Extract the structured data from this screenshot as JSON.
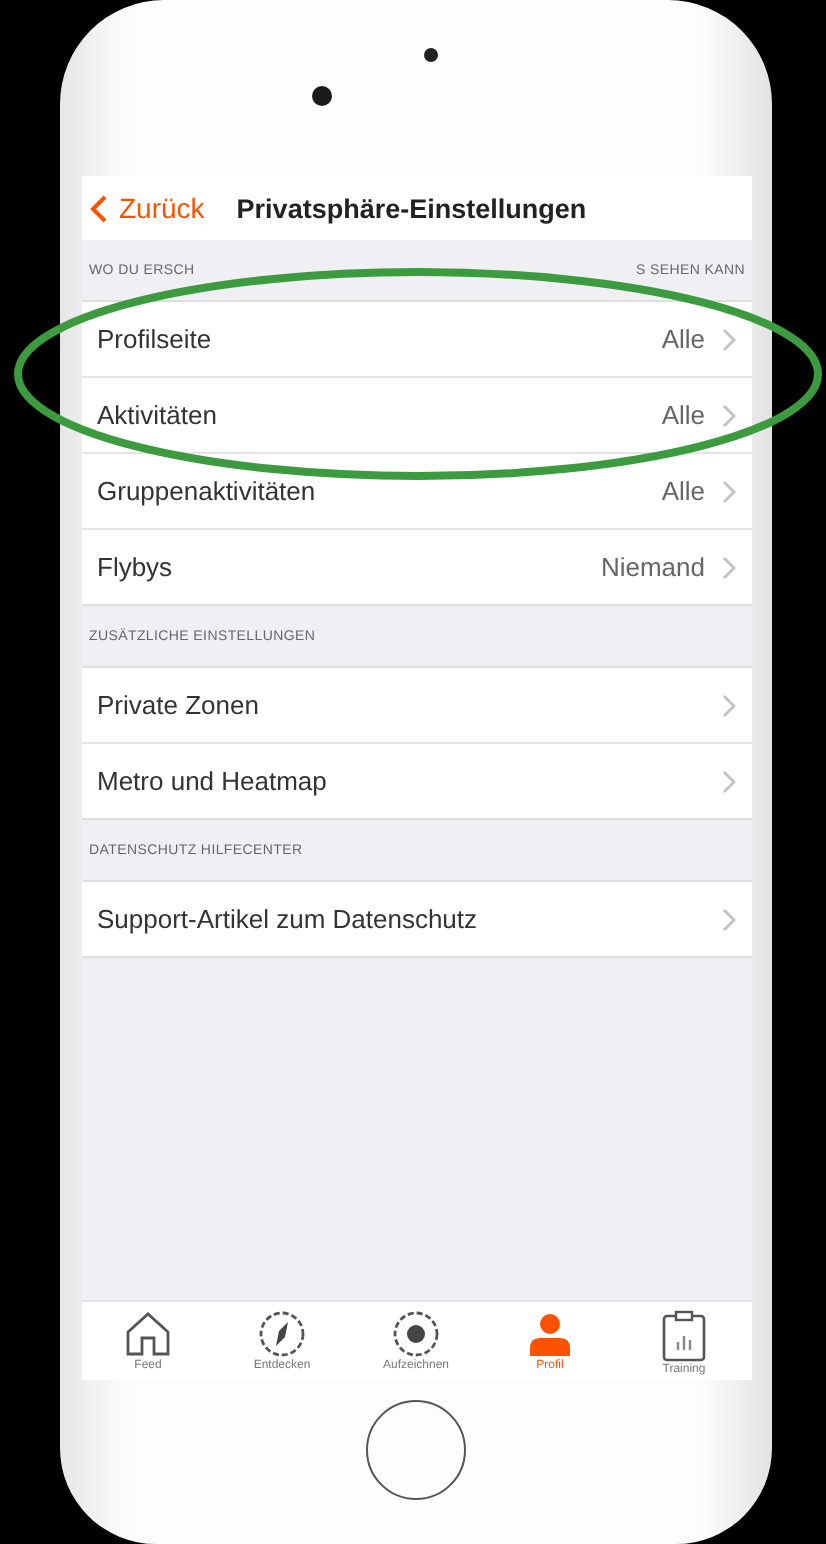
{
  "nav": {
    "back": "Zurück",
    "title": "Privatsphäre-Einstellungen"
  },
  "sections": [
    {
      "header_left": "WO DU ERSCH",
      "header_right": "S SEHEN KANN",
      "rows": [
        {
          "label": "Profilseite",
          "value": "Alle"
        },
        {
          "label": "Aktivitäten",
          "value": "Alle"
        },
        {
          "label": "Gruppenaktivitäten",
          "value": "Alle"
        },
        {
          "label": "Flybys",
          "value": "Niemand"
        }
      ]
    },
    {
      "header_left": "ZUSÄTZLICHE EINSTELLUNGEN",
      "rows": [
        {
          "label": "Private Zonen"
        },
        {
          "label": "Metro und Heatmap"
        }
      ]
    },
    {
      "header_left": "DATENSCHUTZ HILFECENTER",
      "rows": [
        {
          "label": "Support-Artikel zum Datenschutz"
        }
      ]
    }
  ],
  "tabs": [
    {
      "kind": "home",
      "label": "Feed",
      "selected": false
    },
    {
      "kind": "compass",
      "label": "Entdecken",
      "selected": false
    },
    {
      "kind": "record",
      "label": "Aufzeichnen",
      "selected": false
    },
    {
      "kind": "person",
      "label": "Profil",
      "selected": true
    },
    {
      "kind": "clipboard",
      "label": "Training",
      "selected": false
    }
  ]
}
